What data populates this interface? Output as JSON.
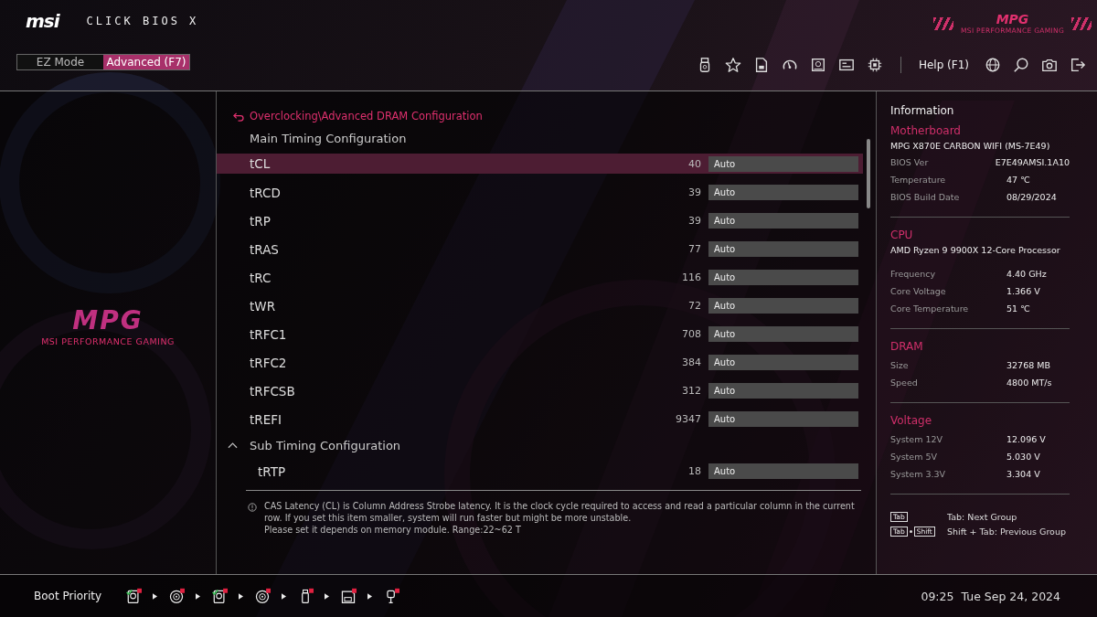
{
  "header": {
    "brand": "msi",
    "product": "CLICK BIOS X",
    "mode_tabs": [
      {
        "label": "EZ Mode",
        "selected": false
      },
      {
        "label": "Advanced (F7)",
        "selected": true
      }
    ],
    "help": "Help (F1)",
    "badge": {
      "logo": "MPG",
      "tagline": "MSI PERFORMANCE GAMING"
    }
  },
  "side_logo": {
    "logo": "MPG",
    "tagline": "MSI PERFORMANCE GAMING"
  },
  "breadcrumb": "Overclocking\\Advanced DRAM Configuration",
  "groups": [
    {
      "title": "Main Timing Configuration",
      "settings": [
        {
          "name": "tCL",
          "value": "40",
          "option": "Auto",
          "selected": true
        },
        {
          "name": "tRCD",
          "value": "39",
          "option": "Auto",
          "selected": false
        },
        {
          "name": "tRP",
          "value": "39",
          "option": "Auto",
          "selected": false
        },
        {
          "name": "tRAS",
          "value": "77",
          "option": "Auto",
          "selected": false
        },
        {
          "name": "tRC",
          "value": "116",
          "option": "Auto",
          "selected": false
        },
        {
          "name": "tWR",
          "value": "72",
          "option": "Auto",
          "selected": false
        },
        {
          "name": "tRFC1",
          "value": "708",
          "option": "Auto",
          "selected": false
        },
        {
          "name": "tRFC2",
          "value": "384",
          "option": "Auto",
          "selected": false
        },
        {
          "name": "tRFCSB",
          "value": "312",
          "option": "Auto",
          "selected": false
        },
        {
          "name": "tREFI",
          "value": "9347",
          "option": "Auto",
          "selected": false
        }
      ]
    },
    {
      "title": "Sub Timing Configuration",
      "expanded": true,
      "settings": [
        {
          "name": "tRTP",
          "value": "18",
          "option": "Auto",
          "selected": false
        }
      ]
    }
  ],
  "help_text": [
    "CAS Latency (CL) is Column Address Strobe latency. It is the clock cycle required to access and read a particular column in the current row. If you set this item smaller, system will run faster but might be more unstable.",
    "Please set it depends on memory module. Range:22~62 T"
  ],
  "info": {
    "title": "Information",
    "sections": [
      {
        "heading": "Motherboard",
        "model": "MPG X870E CARBON WIFI (MS-7E49)",
        "fields": [
          {
            "label": "BIOS Ver",
            "value": "E7E49AMSI.1A10"
          },
          {
            "label": "Temperature",
            "value": "47 ℃"
          },
          {
            "label": "BIOS Build Date",
            "value": "08/29/2024"
          }
        ]
      },
      {
        "heading": "CPU",
        "model": "AMD Ryzen 9 9900X 12-Core Processor",
        "fields": [
          {
            "label": "Frequency",
            "value": "4.40 GHz"
          },
          {
            "label": "Core Voltage",
            "value": "1.366 V"
          },
          {
            "label": "Core Temperature",
            "value": "51 ℃"
          }
        ]
      },
      {
        "heading": "DRAM",
        "fields": [
          {
            "label": "Size",
            "value": "32768 MB"
          },
          {
            "label": "Speed",
            "value": "4800 MT/s"
          }
        ]
      },
      {
        "heading": "Voltage",
        "fields": [
          {
            "label": "System 12V",
            "value": "12.096 V"
          },
          {
            "label": "System 5V",
            "value": "5.030 V"
          },
          {
            "label": "System 3.3V",
            "value": "3.304 V"
          }
        ]
      }
    ],
    "shortcuts": [
      {
        "keys": [
          "Tab"
        ],
        "text": "Tab: Next Group"
      },
      {
        "keys": [
          "Tab",
          "Shift"
        ],
        "text": "Shift + Tab: Previous Group"
      }
    ]
  },
  "footer": {
    "boot_label": "Boot Priority",
    "boot_devices": [
      {
        "kind": "hdd",
        "enabled": true
      },
      {
        "kind": "disc",
        "enabled": false
      },
      {
        "kind": "hdd",
        "enabled": true
      },
      {
        "kind": "disc",
        "enabled": false
      },
      {
        "kind": "usb",
        "enabled": false
      },
      {
        "kind": "card",
        "enabled": false
      },
      {
        "kind": "network",
        "enabled": false
      }
    ],
    "time": "09:25",
    "date": "Tue Sep 24, 2024"
  }
}
